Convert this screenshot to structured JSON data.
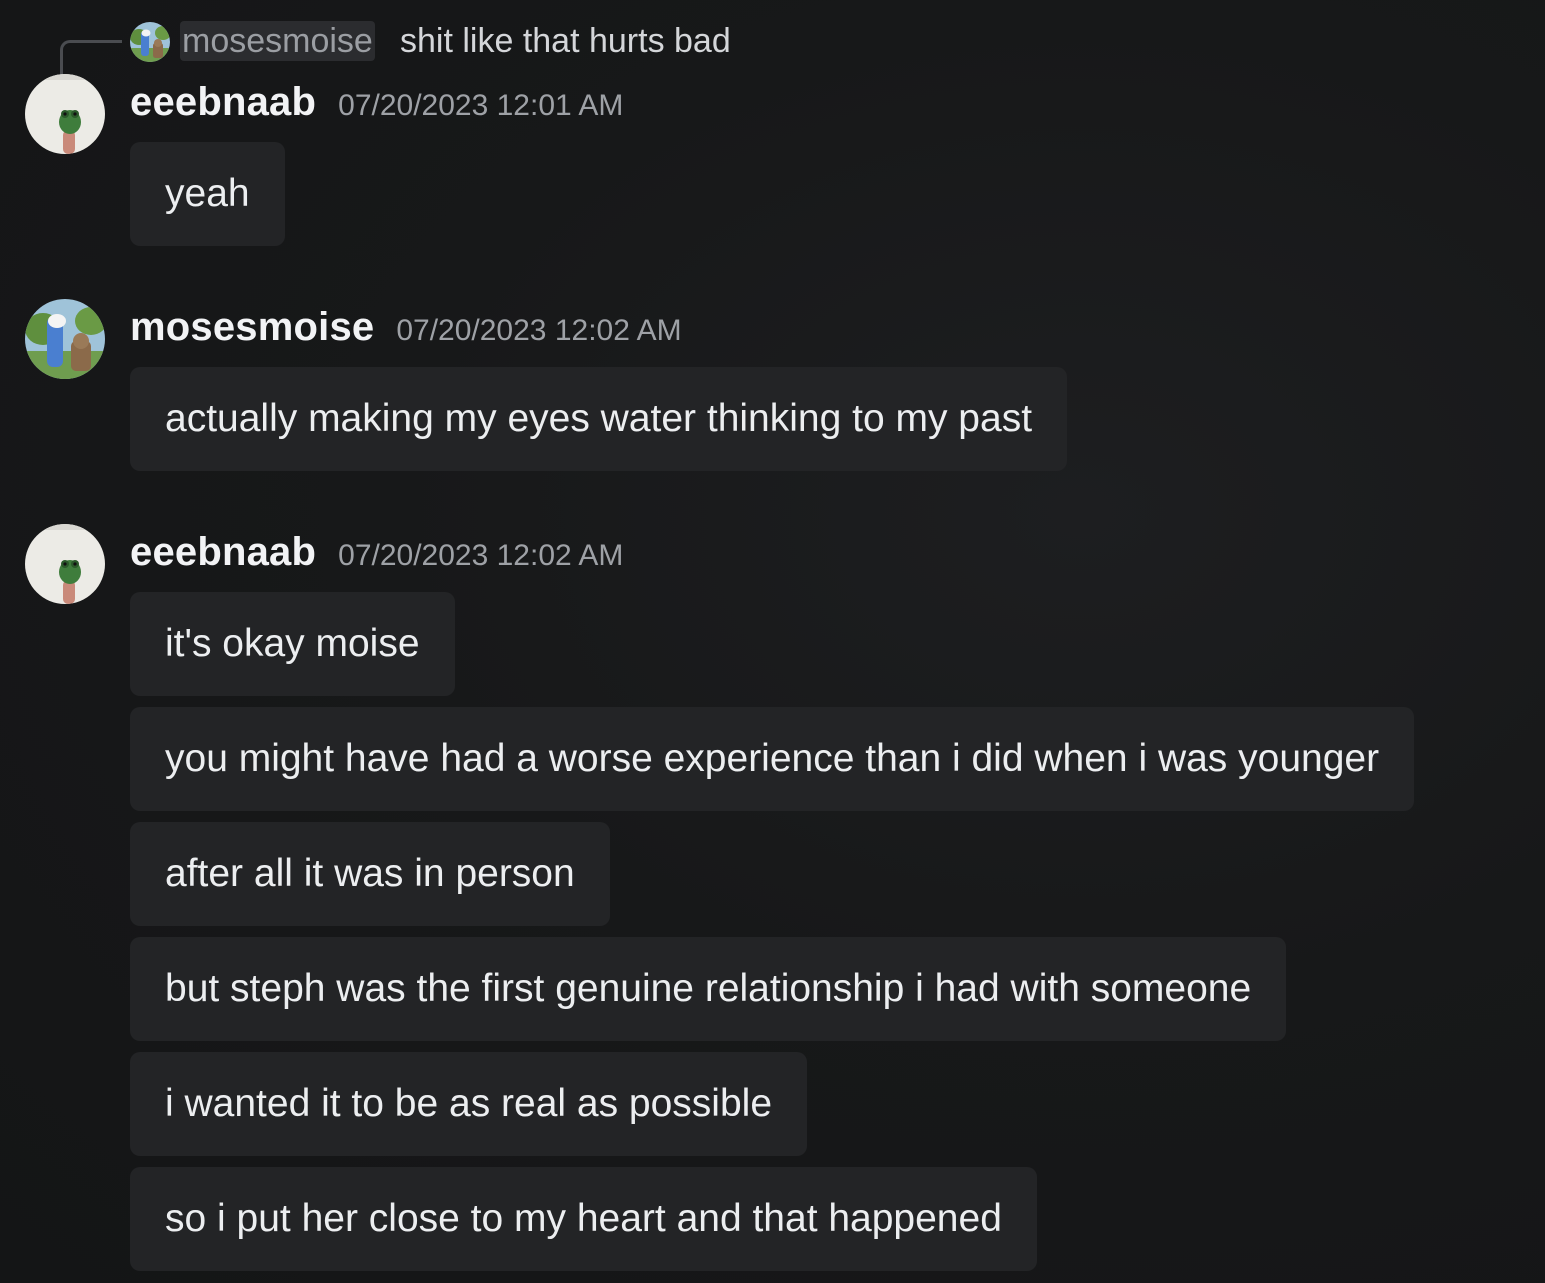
{
  "reply": {
    "author": "mosesmoise",
    "text": "shit like that hurts bad"
  },
  "messages": [
    {
      "author": "eeebnaab",
      "timestamp": "07/20/2023 12:01 AM",
      "lines": [
        "yeah"
      ]
    },
    {
      "author": "mosesmoise",
      "timestamp": "07/20/2023 12:02 AM",
      "lines": [
        "actually making my eyes water thinking to my past"
      ]
    },
    {
      "author": "eeebnaab",
      "timestamp": "07/20/2023 12:02 AM",
      "lines": [
        "it's okay moise",
        "you might have had a worse experience than i did when i was younger",
        "after all it was in person",
        "but steph was the first genuine relationship i had with someone",
        "i wanted it to be as real as possible",
        "so i put her close to my heart and that happened"
      ]
    }
  ],
  "colors": {
    "background": "#161718",
    "bubble": "#232426",
    "author": "#f2f3f5",
    "timestamp": "#9ea1a6",
    "reply_name_bg": "#2b2c2f"
  },
  "icons": {
    "eeebnaab_avatar": "frog-avatar-icon",
    "mosesmoise_avatar": "cartoon-avatar-icon"
  }
}
